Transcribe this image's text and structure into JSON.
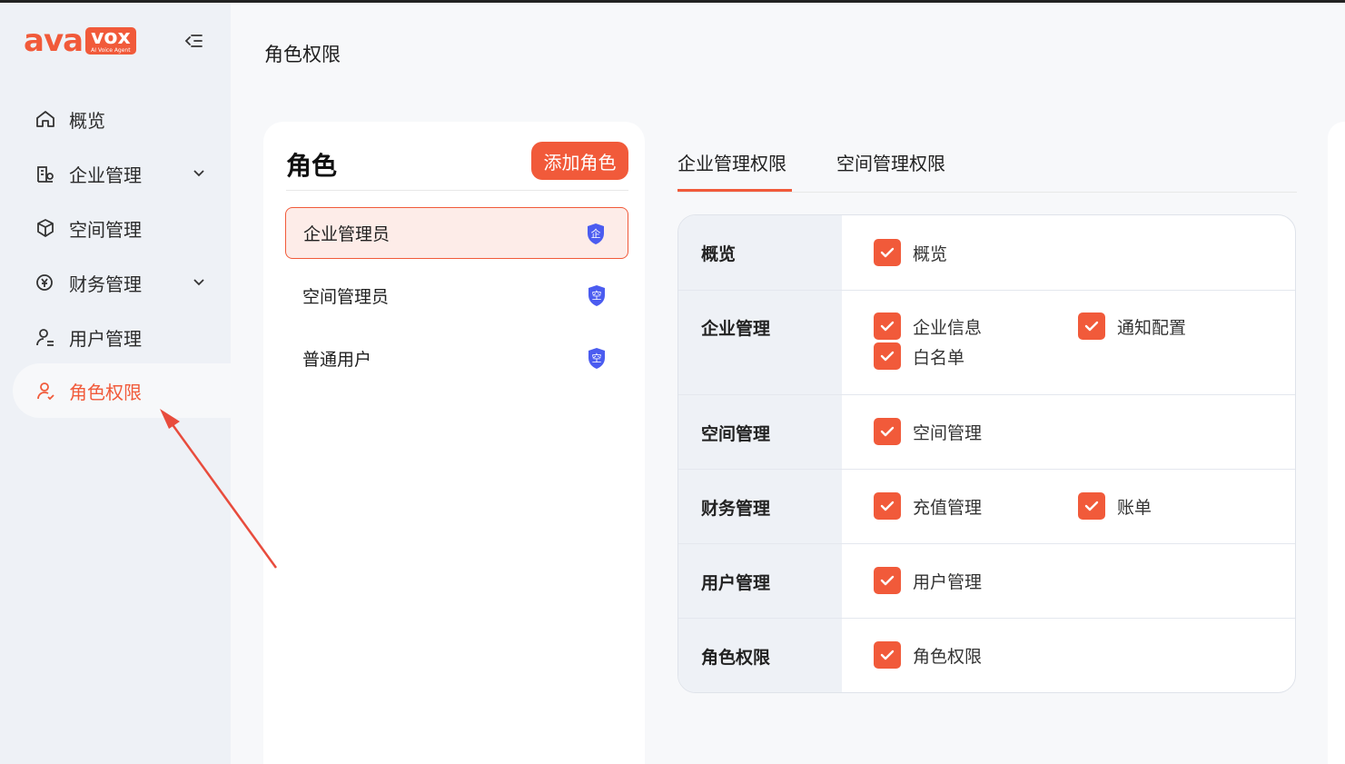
{
  "brand": {
    "logo_main": "ava",
    "logo_box": "vox",
    "logo_sub": "AI Voice Agent",
    "accent": "#f15a3a"
  },
  "sidebar": {
    "items": [
      {
        "label": "概览",
        "icon": "home-icon"
      },
      {
        "label": "企业管理",
        "icon": "enterprise-icon",
        "expandable": true
      },
      {
        "label": "空间管理",
        "icon": "space-icon"
      },
      {
        "label": "财务管理",
        "icon": "finance-icon",
        "expandable": true
      },
      {
        "label": "用户管理",
        "icon": "user-icon"
      },
      {
        "label": "角色权限",
        "icon": "role-icon",
        "active": true
      }
    ]
  },
  "page": {
    "title": "角色权限"
  },
  "roles": {
    "title": "角色",
    "add_label": "添加角色",
    "items": [
      {
        "label": "企业管理员",
        "badge": "企",
        "selected": true
      },
      {
        "label": "空间管理员",
        "badge": "空"
      },
      {
        "label": "普通用户",
        "badge": "空"
      }
    ]
  },
  "tabs": [
    {
      "label": "企业管理权限",
      "active": true
    },
    {
      "label": "空间管理权限"
    }
  ],
  "permissions": [
    {
      "group": "概览",
      "options": [
        "概览"
      ]
    },
    {
      "group": "企业管理",
      "options": [
        "企业信息",
        "通知配置",
        "白名单"
      ]
    },
    {
      "group": "空间管理",
      "options": [
        "空间管理"
      ]
    },
    {
      "group": "财务管理",
      "options": [
        "充值管理",
        "账单"
      ]
    },
    {
      "group": "用户管理",
      "options": [
        "用户管理"
      ]
    },
    {
      "group": "角色权限",
      "options": [
        "角色权限"
      ]
    }
  ]
}
